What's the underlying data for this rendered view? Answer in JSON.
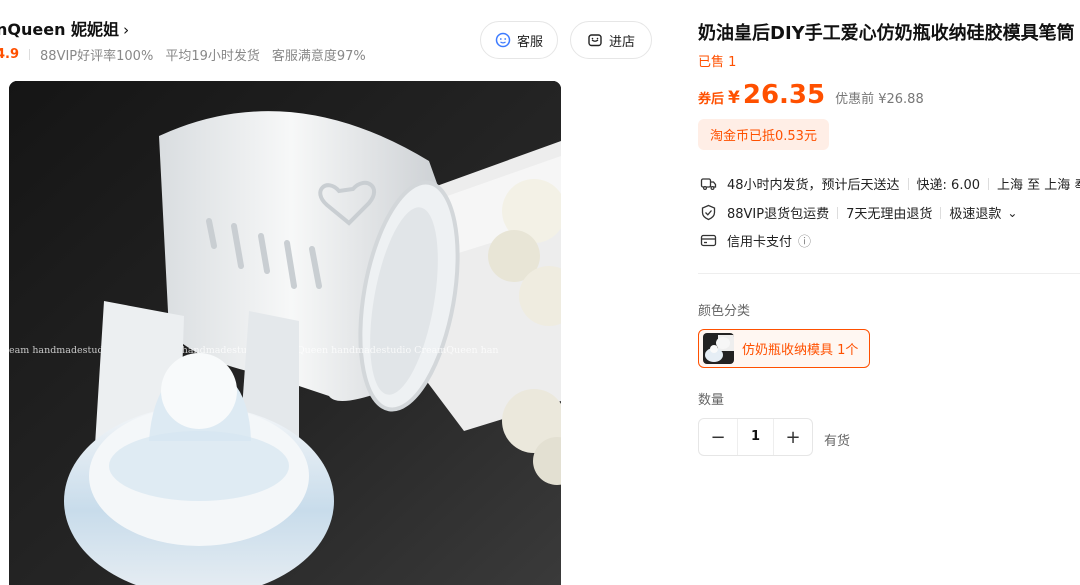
{
  "shop": {
    "name": "nQueen 妮妮姐",
    "chevron": "›",
    "score": "4.9",
    "stats": [
      "88VIP好评率100%",
      "平均19小时发货",
      "客服满意度97%"
    ],
    "buttons": {
      "service": "客服",
      "store": "进店"
    }
  },
  "product": {
    "title": "奶油皇后DIY手工爱心仿奶瓶收纳硅胶模具笔筒",
    "sold": "已售 1",
    "price": {
      "tag": "券后",
      "currency": "¥",
      "amount": "26.35",
      "original": "优惠前 ¥26.88"
    },
    "coin_badge": "淘金币已抵0.53元",
    "image_watermark": "eam handmadestudio CreamQueen handmadestudio CreamQueen handmadestudio CreamQueen han"
  },
  "services": {
    "shipping": {
      "text": "48小时内发货，预计后天送达",
      "fee": "快递: 6.00",
      "route": "上海 至 上海 奉"
    },
    "returns": {
      "vip": "88VIP退货包运费",
      "no_reason": "7天无理由退货",
      "refund": "极速退款",
      "more": "⌄"
    },
    "payment": {
      "text": "信用卡支付",
      "info": "ⓘ"
    }
  },
  "options": {
    "color_label": "颜色分类",
    "sku_text": "仿奶瓶收纳模具 1个",
    "qty_label": "数量",
    "qty_minus": "−",
    "qty_value": "1",
    "qty_plus": "+",
    "stock": "有货"
  },
  "colors": {
    "accent": "#ff5000",
    "badge_bg": "#ffeee6"
  }
}
